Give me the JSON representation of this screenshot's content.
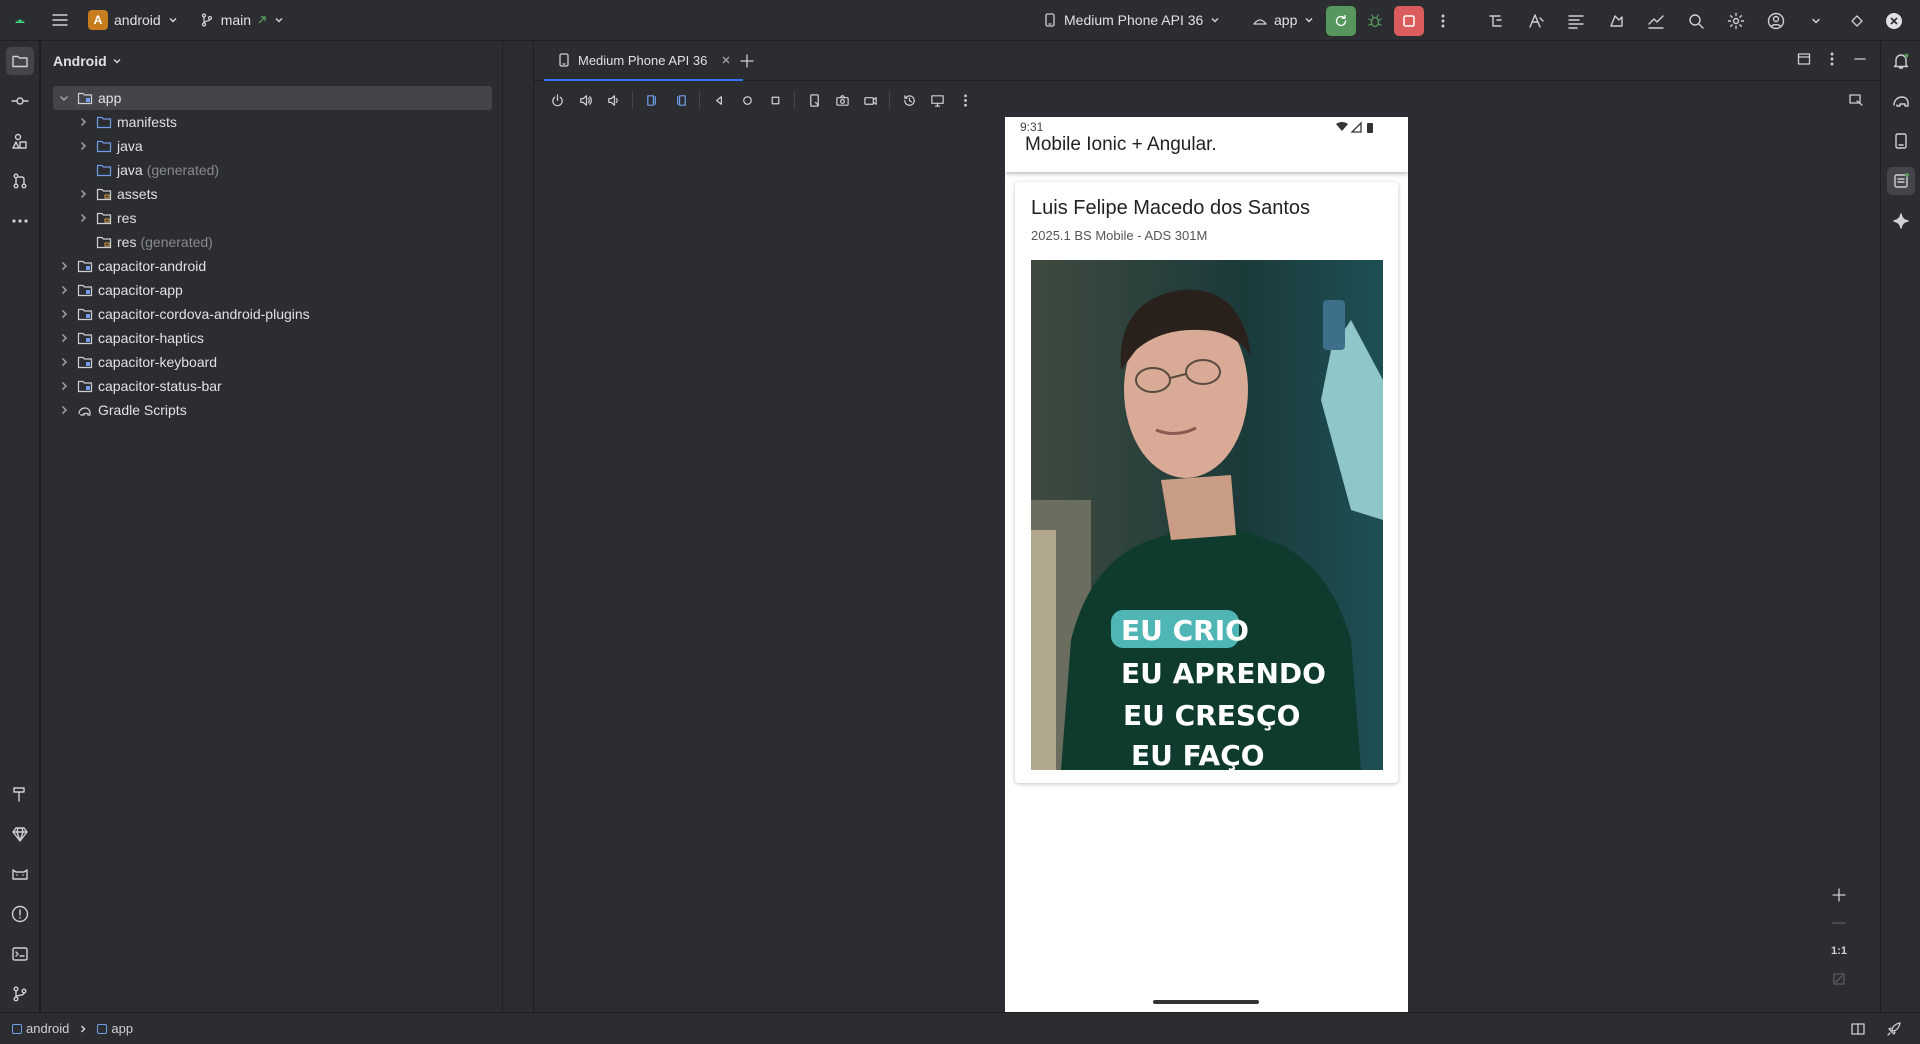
{
  "titlebar": {
    "project_initial": "A",
    "project_name": "android",
    "branch": "main",
    "device": "Medium Phone API 36",
    "run_config": "app"
  },
  "project_panel": {
    "view_mode": "Android",
    "tree": [
      {
        "label": "app",
        "generated": "",
        "selected": true
      },
      {
        "label": "manifests",
        "generated": ""
      },
      {
        "label": "java",
        "generated": ""
      },
      {
        "label": "java",
        "generated": "(generated)"
      },
      {
        "label": "assets",
        "generated": ""
      },
      {
        "label": "res",
        "generated": ""
      },
      {
        "label": "res",
        "generated": "(generated)"
      },
      {
        "label": "capacitor-android",
        "generated": ""
      },
      {
        "label": "capacitor-app",
        "generated": ""
      },
      {
        "label": "capacitor-cordova-android-plugins",
        "generated": ""
      },
      {
        "label": "capacitor-haptics",
        "generated": ""
      },
      {
        "label": "capacitor-keyboard",
        "generated": ""
      },
      {
        "label": "capacitor-status-bar",
        "generated": ""
      },
      {
        "label": "Gradle Scripts",
        "generated": ""
      }
    ]
  },
  "devices": {
    "tab_label": "Medium Phone API 36"
  },
  "phone": {
    "time": "9:31",
    "app_title": "Mobile Ionic + Angular.",
    "card_title": "Luis Felipe Macedo dos Santos",
    "card_subtitle": "2025.1 BS Mobile - ADS 301M",
    "shirt_lines": [
      "EU CRIO",
      "EU APRENDO",
      "EU CRESÇO",
      "EU FAÇO"
    ]
  },
  "zoom": {
    "one_to_one": "1:1"
  },
  "breadcrumb": {
    "root": "android",
    "child": "app"
  },
  "colors": {
    "accent": "#3574f0",
    "run_green": "#57965c",
    "stop_red": "#db5c5c",
    "project_badge": "#c77d1d"
  }
}
